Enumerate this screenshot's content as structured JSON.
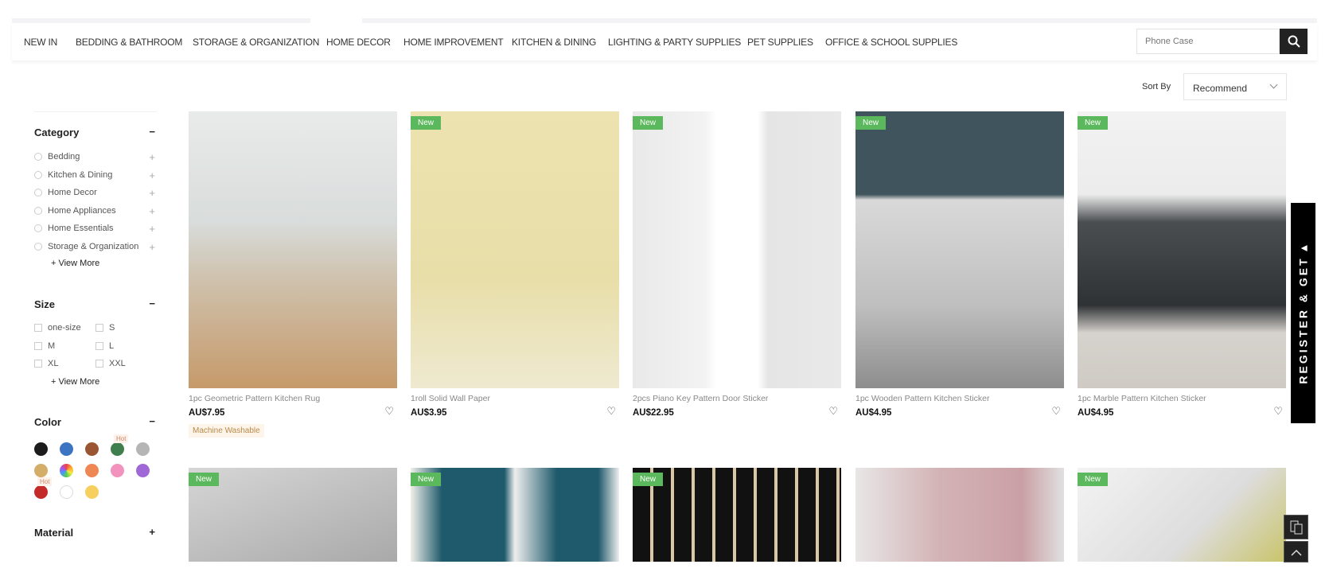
{
  "nav": {
    "items": [
      "NEW IN",
      "BEDDING & BATHROOM",
      "STORAGE & ORGANIZATION",
      "HOME DECOR",
      "HOME IMPROVEMENT",
      "KITCHEN & DINING",
      "LIGHTING & PARTY SUPPLIES",
      "PET SUPPLIES",
      "OFFICE & SCHOOL SUPPLIES"
    ],
    "search_placeholder": "Phone Case"
  },
  "sort": {
    "label": "Sort By",
    "value": "Recommend"
  },
  "sidebar": {
    "category": {
      "title": "Category",
      "toggle": "−",
      "items": [
        "Bedding",
        "Kitchen & Dining",
        "Home Decor",
        "Home Appliances",
        "Home Essentials",
        "Storage & Organization"
      ],
      "view_more": "+ View More"
    },
    "size": {
      "title": "Size",
      "toggle": "−",
      "items": [
        "one-size",
        "S",
        "M",
        "L",
        "XL",
        "XXL"
      ],
      "view_more": "+ View More"
    },
    "color": {
      "title": "Color",
      "toggle": "−",
      "swatches": [
        "#1c1c1c",
        "#3d74c2",
        "#9a5532",
        "#3f7f4e",
        "#b5b5b5",
        "#d4ad69",
        "rainbow",
        "#ef8755",
        "#f193bd",
        "#a068d6",
        "#c42a27",
        "#ffffff",
        "#f6cf5e"
      ],
      "hot_label": "Hot"
    },
    "material": {
      "title": "Material",
      "toggle": "+"
    }
  },
  "products": [
    {
      "title": "1pc Geometric Pattern Kitchen Rug",
      "price": "AU$7.95",
      "badge": "",
      "tag": "Machine Washable"
    },
    {
      "title": "1roll Solid Wall Paper",
      "price": "AU$3.95",
      "badge": "New"
    },
    {
      "title": "2pcs Piano Key Pattern Door Sticker",
      "price": "AU$22.95",
      "badge": "New"
    },
    {
      "title": "1pc Wooden Pattern Kitchen Sticker",
      "price": "AU$4.95",
      "badge": "New"
    },
    {
      "title": "1pc Marble Pattern Kitchen Sticker",
      "price": "AU$4.95",
      "badge": "New"
    }
  ],
  "products_row2": [
    {
      "badge": "New"
    },
    {
      "badge": "New"
    },
    {
      "badge": "New"
    },
    {
      "badge": ""
    },
    {
      "badge": "New"
    }
  ],
  "register_tab": "REGISTER & GET ▴"
}
